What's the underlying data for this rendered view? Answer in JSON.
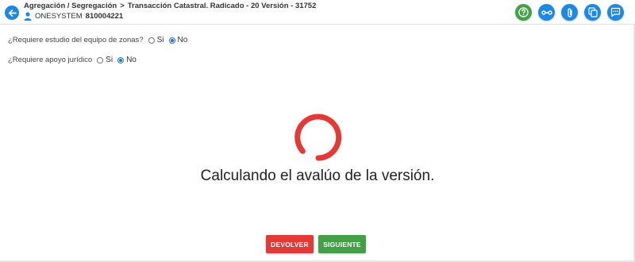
{
  "header": {
    "breadcrumb_part1": "Agregación / Segregación",
    "breadcrumb_sep": ">",
    "breadcrumb_part2": "Transacción Catastral. Radicado - 20 Versión - 31752",
    "user_name": "ONESYSTEM",
    "user_id": "810004221",
    "back_icon": "arrow-left-icon",
    "action_icons": [
      "help-icon",
      "link-icon",
      "attachment-icon",
      "copy-icon",
      "comment-icon"
    ]
  },
  "form": {
    "q1_label": "¿Requiere estudio del equipo de zonas?",
    "q1_options": [
      "Si",
      "No"
    ],
    "q1_selected": "No",
    "q2_label": "¿Requiere apoyo jurídico",
    "q2_options": [
      "Si",
      "No"
    ],
    "q2_selected": "No"
  },
  "loading": {
    "message": "Calculando el avalúo de la versión."
  },
  "footer": {
    "return_label": "DEVOLVER",
    "next_label": "SIGUIENTE"
  },
  "colors": {
    "primary": "#1e88e5",
    "success": "#43a047",
    "danger": "#e53935",
    "spinner": "#e53935"
  }
}
